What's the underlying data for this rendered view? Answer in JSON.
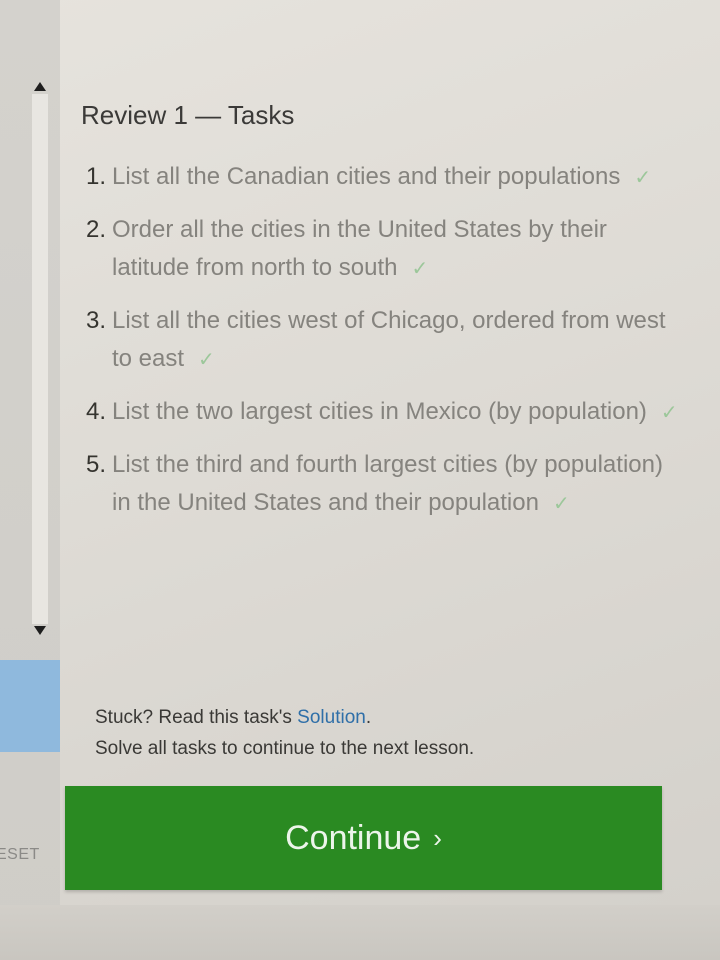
{
  "sidebar": {
    "reset_label": "ESET",
    "scroll_up_icon": "triangle-up",
    "scroll_down_icon": "triangle-down"
  },
  "panel": {
    "title": "Review 1 — Tasks",
    "tasks": [
      {
        "number": "1.",
        "text": "List all the Canadian cities and their populations",
        "completed": true
      },
      {
        "number": "2.",
        "text": "Order all the cities in the United States by their latitude from north to south",
        "completed": true
      },
      {
        "number": "3.",
        "text": "List all the cities west of Chicago, ordered from west to east",
        "completed": true
      },
      {
        "number": "4.",
        "text": "List the two largest cities in Mexico (by population)",
        "completed": true
      },
      {
        "number": "5.",
        "text": "List the third and fourth largest cities (by population) in the United States and their population",
        "completed": true
      }
    ],
    "check_mark": "✓",
    "help": {
      "prefix": "Stuck? Read this task's ",
      "link_text": "Solution",
      "suffix": ".",
      "line2": "Solve all tasks to continue to the next lesson."
    },
    "continue_label": "Continue",
    "continue_chevron": "›"
  },
  "colors": {
    "continue_bg": "#2a8a22",
    "check": "#9cc79a",
    "link": "#2f6fa8",
    "editor_highlight": "#8fb9dd"
  }
}
